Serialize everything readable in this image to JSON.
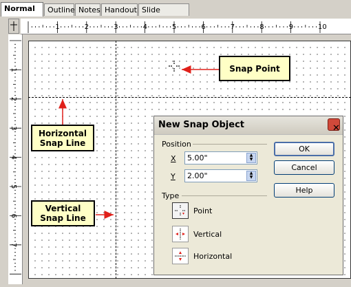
{
  "tabs": [
    "Normal",
    "Outline",
    "Notes",
    "Handout",
    "Slide Sorter"
  ],
  "ruler": {
    "top_numbers": [
      "1",
      "2",
      "3",
      "4",
      "5",
      "6",
      "7",
      "8",
      "9",
      "10"
    ],
    "left_numbers": [
      "1",
      "2",
      "3",
      "4",
      "5",
      "6",
      "7"
    ]
  },
  "callouts": {
    "snap_point": "Snap Point",
    "horizontal_line1": "Horizontal",
    "horizontal_line2": "Snap Line",
    "vertical_line1": "Vertical",
    "vertical_line2": "Snap Line"
  },
  "dialog": {
    "title": "New Snap Object",
    "position_group": "Position",
    "x_label": "X",
    "x_value": "5.00\"",
    "y_label": "Y",
    "y_value": "2.00\"",
    "type_group": "Type",
    "type_point": "Point",
    "type_vertical": "Vertical",
    "type_horizontal": "Horizontal",
    "ok": "OK",
    "cancel": "Cancel",
    "help": "Help"
  },
  "colors": {
    "arrow": "#e0201a",
    "callout_bg": "#ffffc6"
  }
}
